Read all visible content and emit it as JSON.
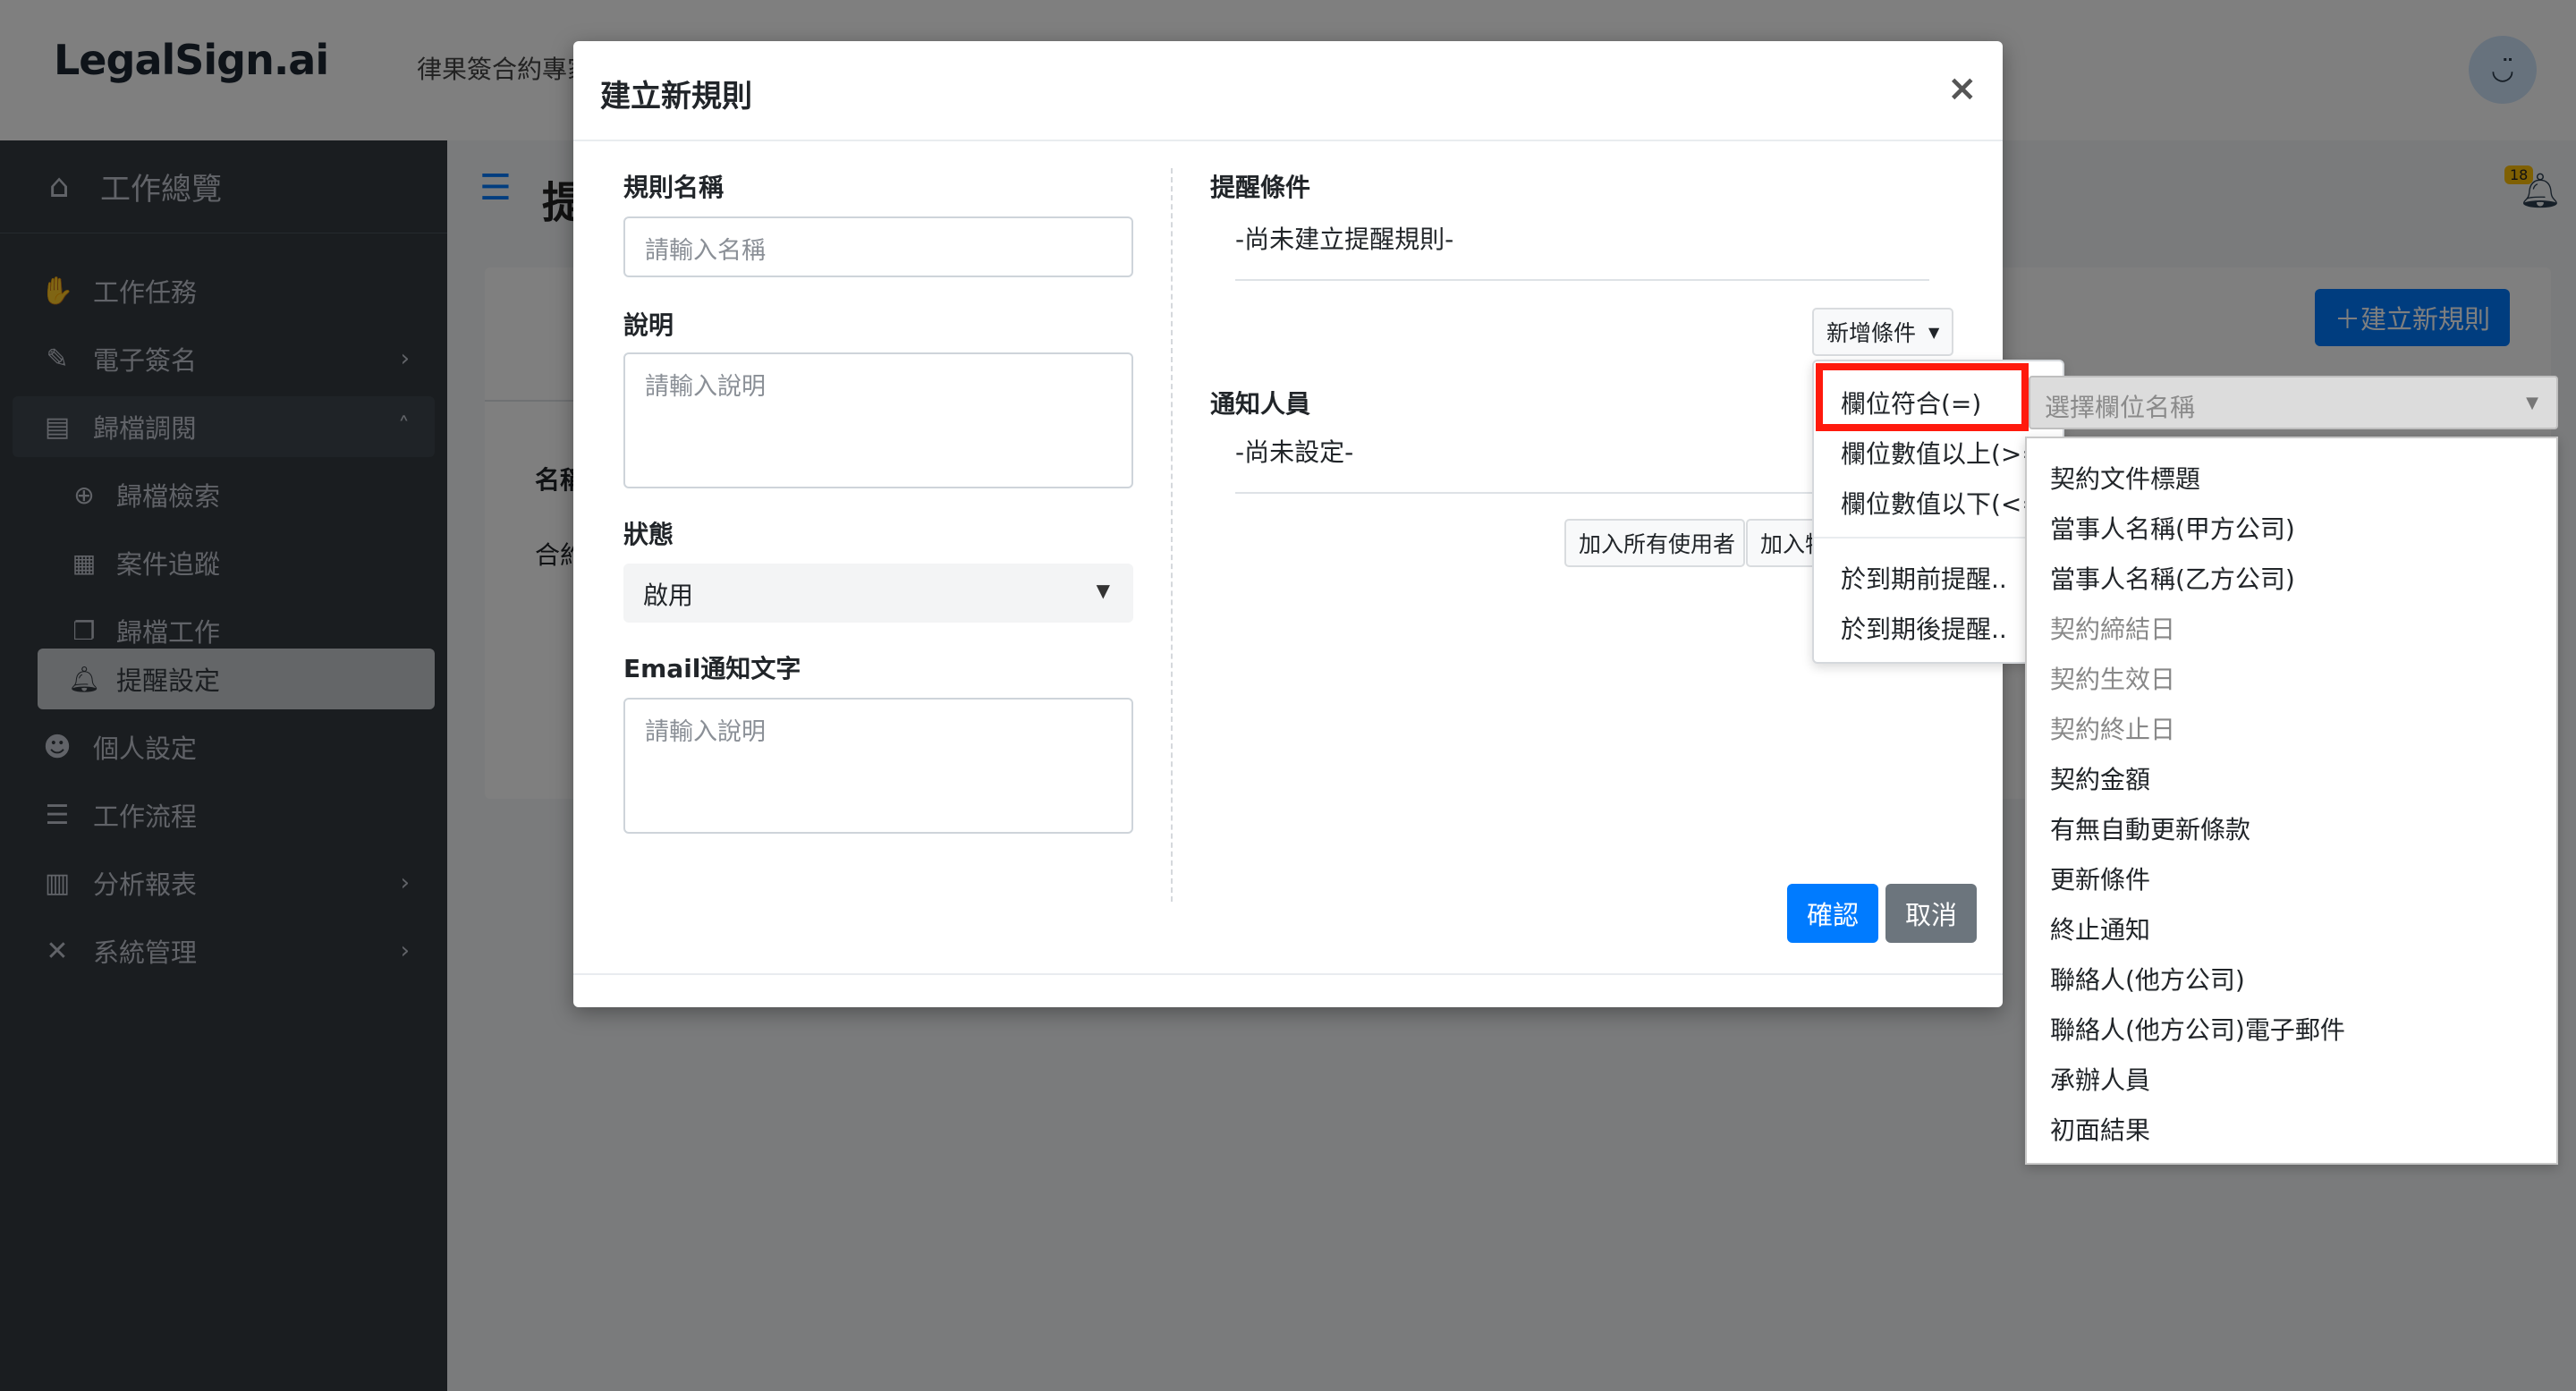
{
  "header": {
    "logo": "LegalSign.ai",
    "subtitle": "律果簽合約專家",
    "avatar_face": "◡̈"
  },
  "sidebar": {
    "home": "工作總覽",
    "items": [
      {
        "label": "工作任務",
        "icon": "handshake-icon"
      },
      {
        "label": "電子簽名",
        "icon": "signature-icon"
      },
      {
        "label": "歸檔調閱",
        "icon": "archive-icon"
      },
      {
        "label": "個人設定",
        "icon": "user-cog-icon"
      },
      {
        "label": "工作流程",
        "icon": "list-check-icon"
      },
      {
        "label": "分析報表",
        "icon": "chart-icon"
      },
      {
        "label": "系統管理",
        "icon": "tools-icon"
      }
    ],
    "sub_items": [
      {
        "label": "歸檔檢索",
        "icon": "search-plus-icon"
      },
      {
        "label": "案件追蹤",
        "icon": "calendar-check-icon"
      },
      {
        "label": "歸檔工作",
        "icon": "copy-icon"
      },
      {
        "label": "提醒設定",
        "icon": "bell-icon"
      }
    ]
  },
  "main": {
    "page_title": "提",
    "notification_count": "18",
    "create_button": "建立新規則",
    "table_header": "名稱",
    "table_cell": "合約"
  },
  "modal": {
    "title": "建立新規則",
    "close": "×",
    "rule_name_label": "規則名稱",
    "rule_name_placeholder": "請輸入名稱",
    "description_label": "說明",
    "description_placeholder": "請輸入說明",
    "status_label": "狀態",
    "status_value": "啟用",
    "email_label": "Email通知文字",
    "email_placeholder": "請輸入說明",
    "conditions_label": "提醒條件",
    "conditions_empty": "-尚未建立提醒規則-",
    "add_condition_button": "新增條件",
    "notify_label": "通知人員",
    "notify_empty": "-尚未設定-",
    "add_all_users_button": "加入所有使用者",
    "add_specific_button": "加入特定使用者",
    "confirm_button": "確認",
    "cancel_button": "取消"
  },
  "condition_menu": {
    "items": [
      "欄位符合(=)",
      "欄位數值以上(>=)",
      "欄位數值以下(<=)",
      "於到期前提醒..",
      "於到期後提醒.."
    ]
  },
  "field_select": {
    "placeholder": "選擇欄位名稱",
    "options": [
      "契約文件標題",
      "當事人名稱(甲方公司)",
      "當事人名稱(乙方公司)",
      "契約締結日",
      "契約生效日",
      "契約終止日",
      "契約金額",
      "有無自動更新條款",
      "更新條件",
      "終止通知",
      "聯絡人(他方公司)",
      "聯絡人(他方公司)電子郵件",
      "承辦人員",
      "初面結果"
    ]
  }
}
